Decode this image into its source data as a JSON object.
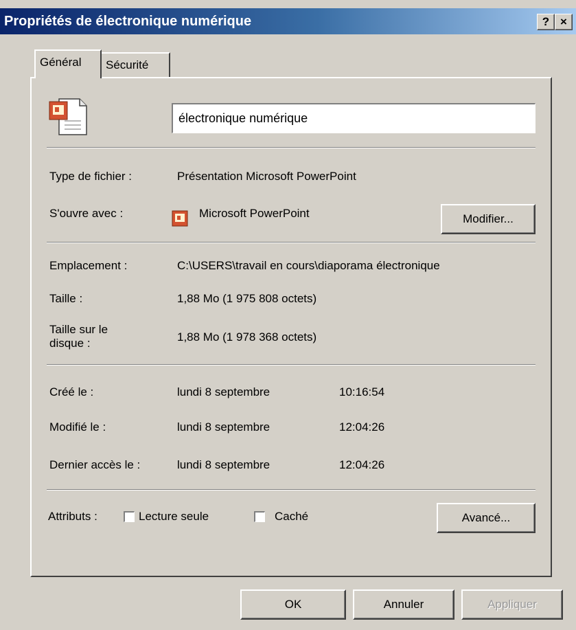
{
  "window": {
    "title": "Propriétés de électronique numérique",
    "help_button": "?",
    "close_button": "×"
  },
  "tabs": [
    {
      "label": "Général",
      "active": true
    },
    {
      "label": "Sécurité",
      "active": false
    }
  ],
  "general": {
    "file_name": "électronique numérique",
    "file_icon": "powerpoint-file-icon",
    "type_label": "Type de fichier :",
    "type_value": "Présentation Microsoft PowerPoint",
    "opens_with_label": "S'ouvre avec :",
    "opens_with_value": "Microsoft PowerPoint",
    "opens_with_icon": "powerpoint-app-icon",
    "modify_button": "Modifier...",
    "location_label": "Emplacement :",
    "location_value": "C:\\USERS\\travail en cours\\diaporama électronique",
    "size_label": "Taille :",
    "size_value": "1,88 Mo (1 975 808 octets)",
    "size_on_disk_label_1": "Taille sur le",
    "size_on_disk_label_2": "disque :",
    "size_on_disk_value": "1,88 Mo (1 978 368 octets)",
    "created_label": "Créé le :",
    "created_date": "lundi 8 septembre",
    "created_time": "10:16:54",
    "modified_label": "Modifié le :",
    "modified_date": "lundi 8 septembre",
    "modified_time": "12:04:26",
    "accessed_label": "Dernier accès le :",
    "accessed_date": "lundi 8 septembre",
    "accessed_time": "12:04:26",
    "attributes_label": "Attributs :",
    "readonly_label": "Lecture seule",
    "readonly_checked": false,
    "hidden_label": "Caché",
    "hidden_checked": false,
    "advanced_button": "Avancé..."
  },
  "footer": {
    "ok_button": "OK",
    "cancel_button": "Annuler",
    "apply_button": "Appliquer"
  },
  "colors": {
    "dialog_face": "#d4d0c8",
    "title_gradient_start": "#0a246a",
    "title_gradient_end": "#a6caf0",
    "powerpoint_orange": "#d35230"
  }
}
